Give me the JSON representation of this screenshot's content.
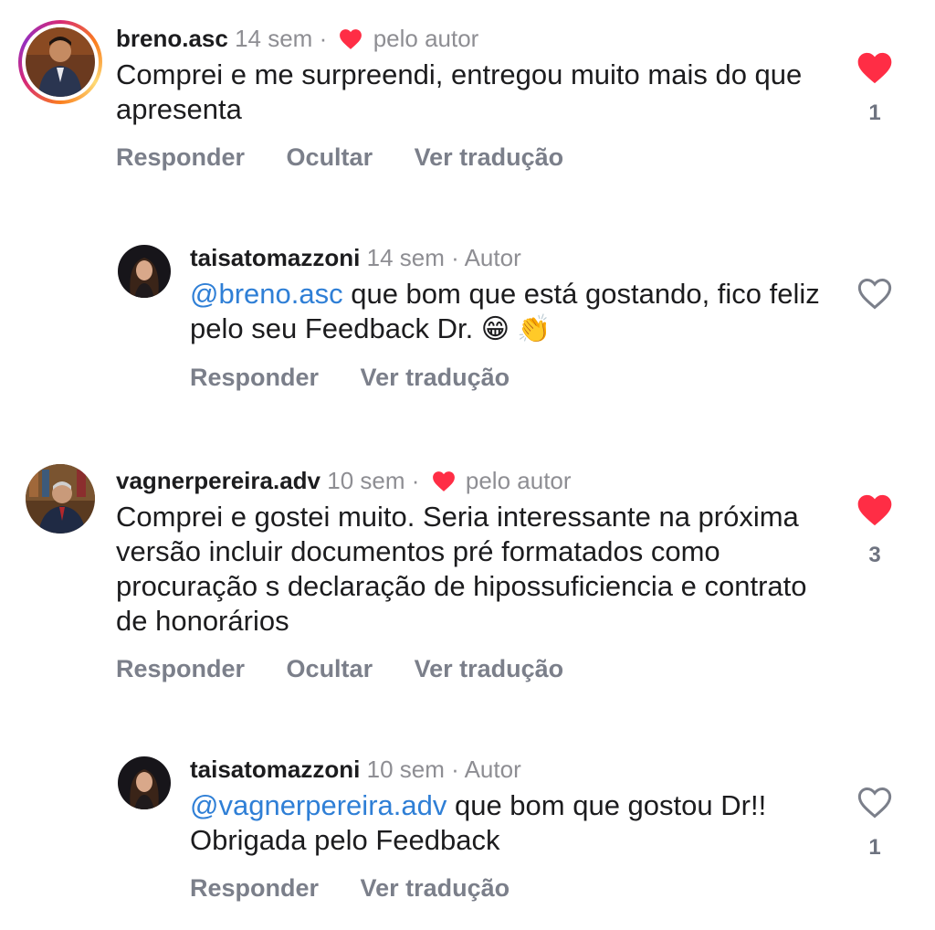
{
  "comments": [
    {
      "username": "breno.asc",
      "time": "14 sem",
      "separator": "·",
      "author_note": "pelo autor",
      "text": "Comprei e me surpreendi, entregou muito mais do que apresenta",
      "actions": [
        "Responder",
        "Ocultar",
        "Ver tradução"
      ],
      "liked": true,
      "like_count": "1"
    },
    {
      "username": "taisatomazzoni",
      "time": "14 sem",
      "separator": "·",
      "author_note": "Autor",
      "mention": "@breno.asc",
      "text": " que bom que está gostando, fico feliz pelo seu Feedback Dr. ",
      "emojis": "😁 👏",
      "actions": [
        "Responder",
        "Ver tradução"
      ],
      "liked": false,
      "like_count": ""
    },
    {
      "username": "vagnerpereira.adv",
      "time": "10 sem",
      "separator": "·",
      "author_note": "pelo autor",
      "text": "Comprei e gostei muito. Seria interessante na próxima versão incluir documentos pré formatados como procuração s declaração de hipossuficiencia e contrato de honorários",
      "actions": [
        "Responder",
        "Ocultar",
        "Ver tradução"
      ],
      "liked": true,
      "like_count": "3"
    },
    {
      "username": "taisatomazzoni",
      "time": "10 sem",
      "separator": "·",
      "author_note": "Autor",
      "mention": "@vagnerpereira.adv",
      "text": " que bom que gostou Dr!! Obrigada pelo Feedback",
      "actions": [
        "Responder",
        "Ver tradução"
      ],
      "liked": false,
      "like_count": "1"
    }
  ],
  "colors": {
    "like_red": "#ff2d45",
    "mention_blue": "#2f7fd6",
    "muted_gray": "#8e8e93",
    "action_gray": "#7b7f8a"
  }
}
